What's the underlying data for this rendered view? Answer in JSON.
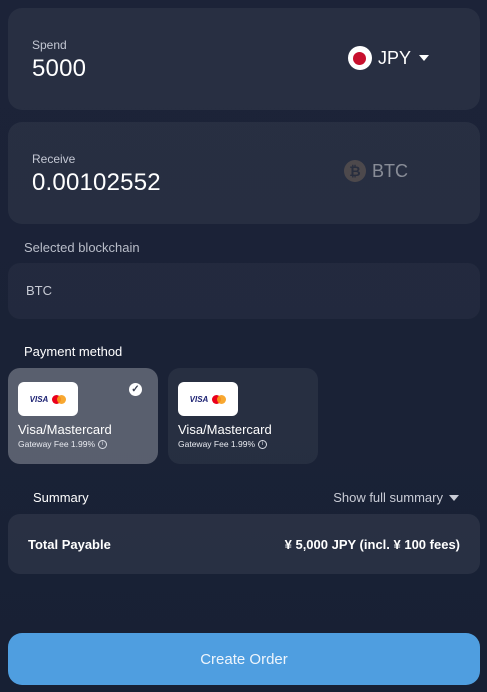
{
  "spend": {
    "label": "Spend",
    "amount": "5000",
    "currency": "JPY"
  },
  "receive": {
    "label": "Receive",
    "amount": "0.00102552",
    "currency": "BTC"
  },
  "blockchain": {
    "label": "Selected blockchain",
    "value": "BTC"
  },
  "payment": {
    "title": "Payment method",
    "methods": [
      {
        "logo_text": "VISA",
        "name": "Visa/Mastercard",
        "fee": "Gateway Fee 1.99%",
        "selected": true
      },
      {
        "logo_text": "VISA",
        "name": "Visa/Mastercard",
        "fee": "Gateway Fee 1.99%",
        "selected": false
      }
    ]
  },
  "summary": {
    "label": "Summary",
    "show_full": "Show full summary",
    "total_label": "Total Payable",
    "total_value": "¥ 5,000 JPY (incl. ¥ 100 fees)"
  },
  "actions": {
    "create_order": "Create Order"
  },
  "colors": {
    "background": "#1c2338",
    "button": "#4f9ee0",
    "flag_red": "#c8102e"
  }
}
